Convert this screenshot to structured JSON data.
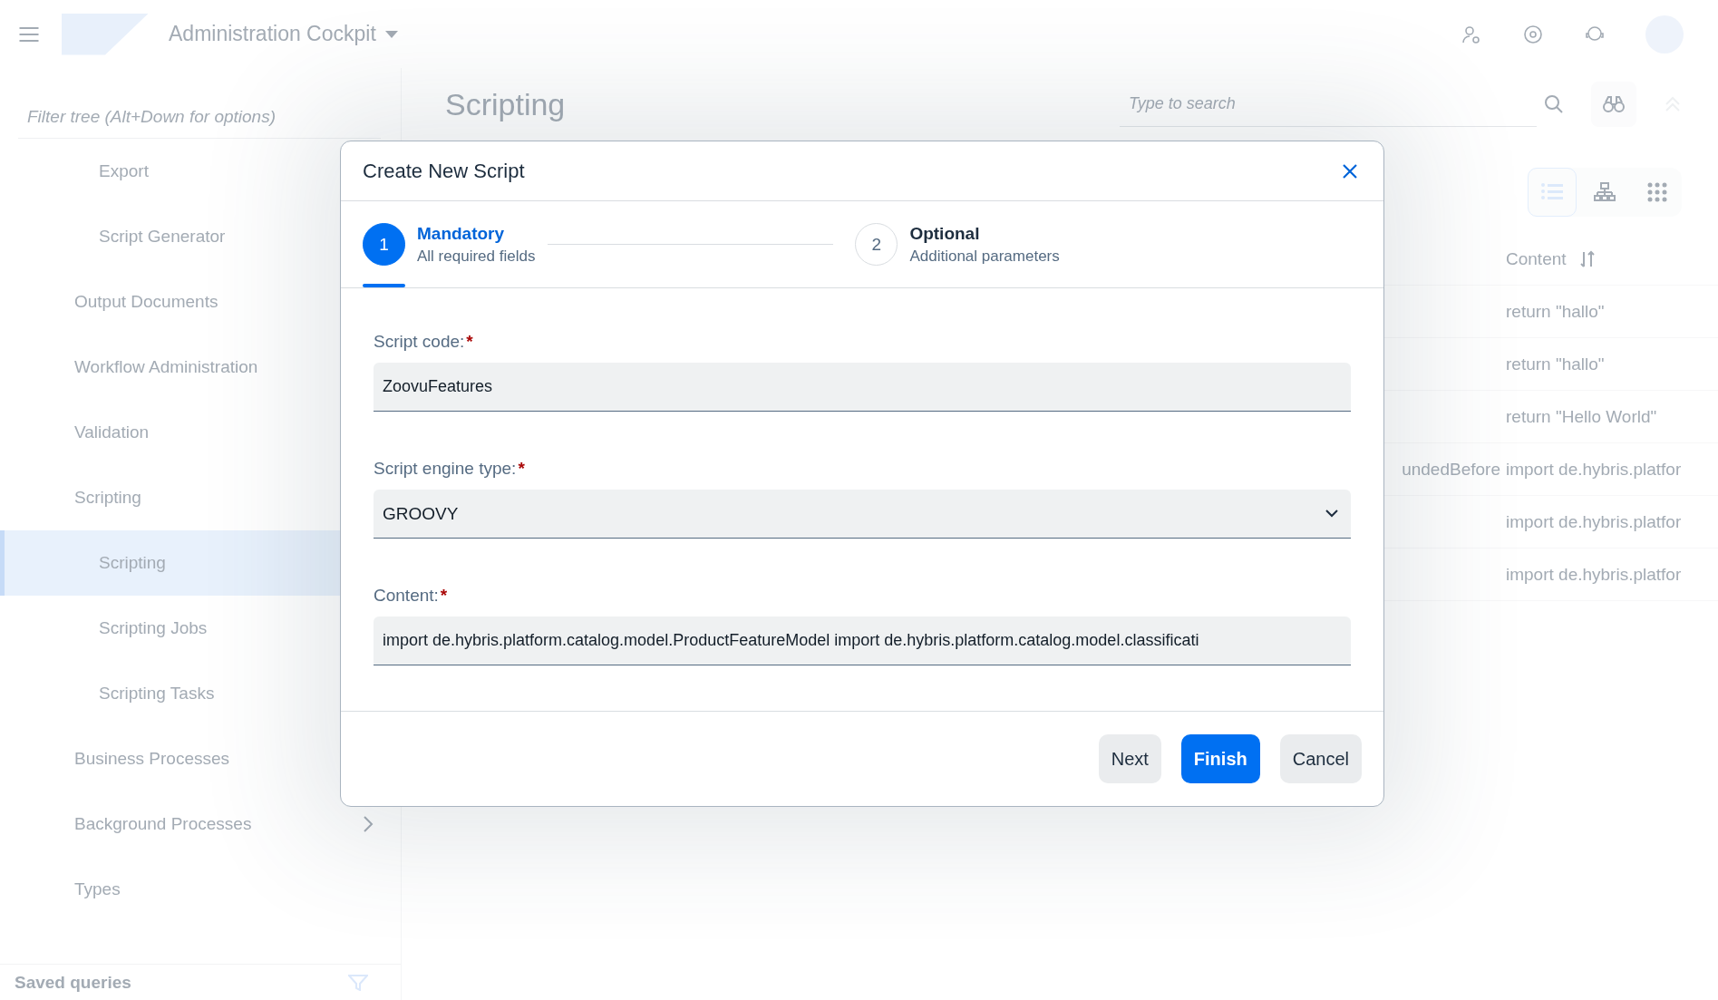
{
  "header": {
    "app_title": "Administration Cockpit"
  },
  "sidebar": {
    "filter_placeholder": "Filter tree (Alt+Down for options)",
    "tree": [
      {
        "children": [
          {
            "label": "Export",
            "selected": false
          },
          {
            "label": "Script Generator",
            "selected": false
          }
        ]
      },
      {
        "label": "Output Documents",
        "selected": false
      },
      {
        "label": "Workflow Administration",
        "selected": false
      },
      {
        "label": "Validation",
        "selected": false
      },
      {
        "label": "Scripting",
        "selected": false,
        "children": [
          {
            "label": "Scripting",
            "selected": true
          },
          {
            "label": "Scripting Jobs",
            "selected": false
          },
          {
            "label": "Scripting Tasks",
            "selected": false
          }
        ]
      },
      {
        "label": "Business Processes",
        "selected": false
      },
      {
        "label": "Background Processes",
        "selected": false,
        "has_arrow": true
      },
      {
        "label": "Types",
        "selected": false
      }
    ],
    "footer_label": "Saved queries"
  },
  "main": {
    "title": "Scripting",
    "search_placeholder": "Type to search",
    "view_modes": [
      {
        "kind": "list",
        "selected": true
      },
      {
        "kind": "hierarchy",
        "selected": false
      },
      {
        "kind": "grid",
        "selected": false
      }
    ],
    "table": {
      "columns": [
        {
          "label": "Content"
        }
      ],
      "rows": [
        {
          "content": "return \"hallo\""
        },
        {
          "content": "return \"hallo\""
        },
        {
          "content": "return \"Hello World\""
        },
        {
          "column_1": "undedBefore",
          "content": "import de.hybris.platfor"
        },
        {
          "content": "import de.hybris.platfor"
        },
        {
          "content": "import de.hybris.platfor"
        }
      ]
    }
  },
  "dialog": {
    "title": "Create New Script",
    "steps": [
      {
        "number": "1",
        "title": "Mandatory",
        "subtitle": "All required fields",
        "selected": true
      },
      {
        "number": "2",
        "title": "Optional",
        "subtitle": "Additional parameters",
        "selected": false
      }
    ],
    "fields": [
      {
        "kind": "text",
        "label": "Script code:",
        "required_mark": "*",
        "value": "ZoovuFeatures"
      },
      {
        "kind": "select",
        "label": "Script engine type:",
        "required_mark": "*",
        "value": "GROOVY"
      },
      {
        "kind": "text",
        "label": "Content:",
        "required_mark": "*",
        "value": "import de.hybris.platform.catalog.model.ProductFeatureModel import de.hybris.platform.catalog.model.classificati"
      }
    ],
    "buttons": [
      {
        "label": "Next",
        "kind": "default"
      },
      {
        "label": "Finish",
        "kind": "emphasized"
      },
      {
        "label": "Cancel",
        "kind": "default"
      }
    ]
  }
}
